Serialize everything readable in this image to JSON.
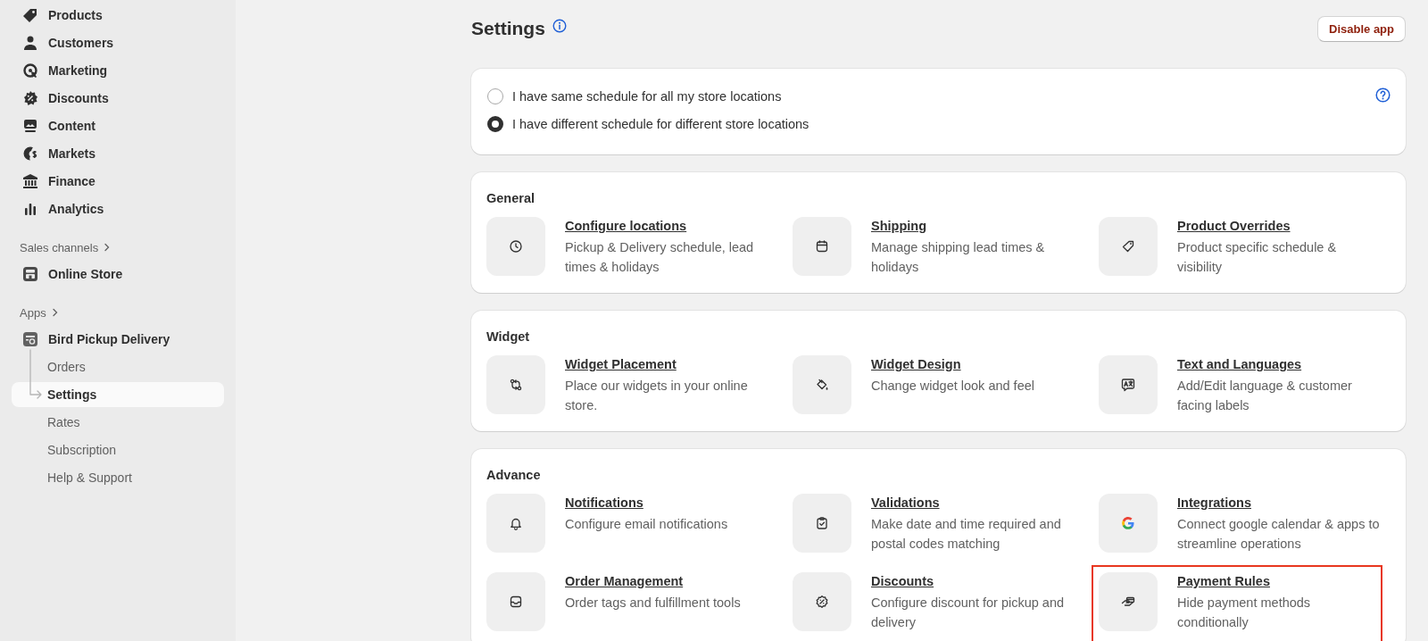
{
  "sidebar": {
    "items": [
      {
        "label": "Products",
        "selected": false
      },
      {
        "label": "Customers",
        "selected": false
      },
      {
        "label": "Marketing",
        "selected": false
      },
      {
        "label": "Discounts",
        "selected": false
      },
      {
        "label": "Content",
        "selected": false
      },
      {
        "label": "Markets",
        "selected": false
      },
      {
        "label": "Finance",
        "selected": false
      },
      {
        "label": "Analytics",
        "selected": false
      }
    ],
    "sales_channels": {
      "heading": "Sales channels",
      "items": [
        {
          "label": "Online Store",
          "selected": false
        }
      ]
    },
    "apps": {
      "heading": "Apps",
      "items": [
        {
          "label": "Bird Pickup Delivery",
          "selected": false,
          "children": [
            {
              "label": "Orders",
              "selected": false
            },
            {
              "label": "Settings",
              "selected": true
            },
            {
              "label": "Rates",
              "selected": false
            },
            {
              "label": "Subscription",
              "selected": false
            },
            {
              "label": "Help & Support",
              "selected": false
            }
          ]
        }
      ]
    }
  },
  "page": {
    "title": "Settings",
    "disable_button": "Disable app"
  },
  "schedule_options": [
    {
      "label": "I have same schedule for all my store locations",
      "selected": false
    },
    {
      "label": "I have different schedule for different store locations",
      "selected": true
    }
  ],
  "sections": [
    {
      "title": "General",
      "items": [
        {
          "title": "Configure locations",
          "description": "Pickup & Delivery schedule, lead times & holidays",
          "highlighted": false
        },
        {
          "title": "Shipping",
          "description": "Manage shipping lead times & holidays",
          "highlighted": false
        },
        {
          "title": "Product Overrides",
          "description": "Product specific schedule & visibility",
          "highlighted": false
        }
      ]
    },
    {
      "title": "Widget",
      "items": [
        {
          "title": "Widget Placement",
          "description": "Place our widgets in your online store.",
          "highlighted": false
        },
        {
          "title": "Widget Design",
          "description": "Change widget look and feel",
          "highlighted": false
        },
        {
          "title": "Text and Languages",
          "description": "Add/Edit language & customer facing labels",
          "highlighted": false
        }
      ]
    },
    {
      "title": "Advance",
      "items": [
        {
          "title": "Notifications",
          "description": "Configure email notifications",
          "highlighted": false
        },
        {
          "title": "Validations",
          "description": "Make date and time required and postal codes matching",
          "highlighted": false
        },
        {
          "title": "Integrations",
          "description": "Connect google calendar & apps to streamline operations",
          "highlighted": false
        },
        {
          "title": "Order Management",
          "description": "Order tags and fulfillment tools",
          "highlighted": false
        },
        {
          "title": "Discounts",
          "description": "Configure discount for pickup and delivery",
          "highlighted": false
        },
        {
          "title": "Payment Rules",
          "description": "Hide payment methods conditionally",
          "highlighted": true
        }
      ]
    }
  ]
}
